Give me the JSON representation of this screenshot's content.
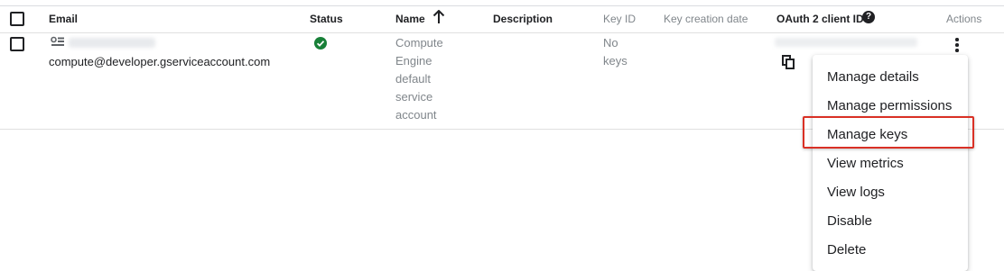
{
  "colors": {
    "status_ok": "#188038",
    "highlight": "#d93025",
    "divider": "#e0e0e0",
    "muted_text": "#80868b"
  },
  "table": {
    "columns": {
      "email": "Email",
      "status": "Status",
      "name": "Name",
      "description": "Description",
      "key_id": "Key ID",
      "key_creation_date": "Key creation date",
      "oauth_client_id": "OAuth 2 client ID",
      "actions": "Actions"
    },
    "sort": {
      "column": "Name",
      "direction": "ascending",
      "icon": "arrow-up-icon"
    },
    "help_icon": "help-circle-icon",
    "rows": [
      {
        "type_icon": "service-account-icon",
        "email": "compute@developer.gserviceaccount.com",
        "status_icon": "check-circle-icon",
        "name_lines": [
          "Compute",
          "Engine",
          "default",
          "service",
          "account"
        ],
        "description": "",
        "key_id_lines": [
          "No",
          "keys"
        ],
        "key_creation_date": "",
        "copy_icon": "copy-icon",
        "actions_icon": "more-vert-icon"
      }
    ]
  },
  "actions_menu": {
    "items": [
      "Manage details",
      "Manage permissions",
      "Manage keys",
      "View metrics",
      "View logs",
      "Disable",
      "Delete"
    ],
    "highlighted_item": "Manage keys"
  }
}
